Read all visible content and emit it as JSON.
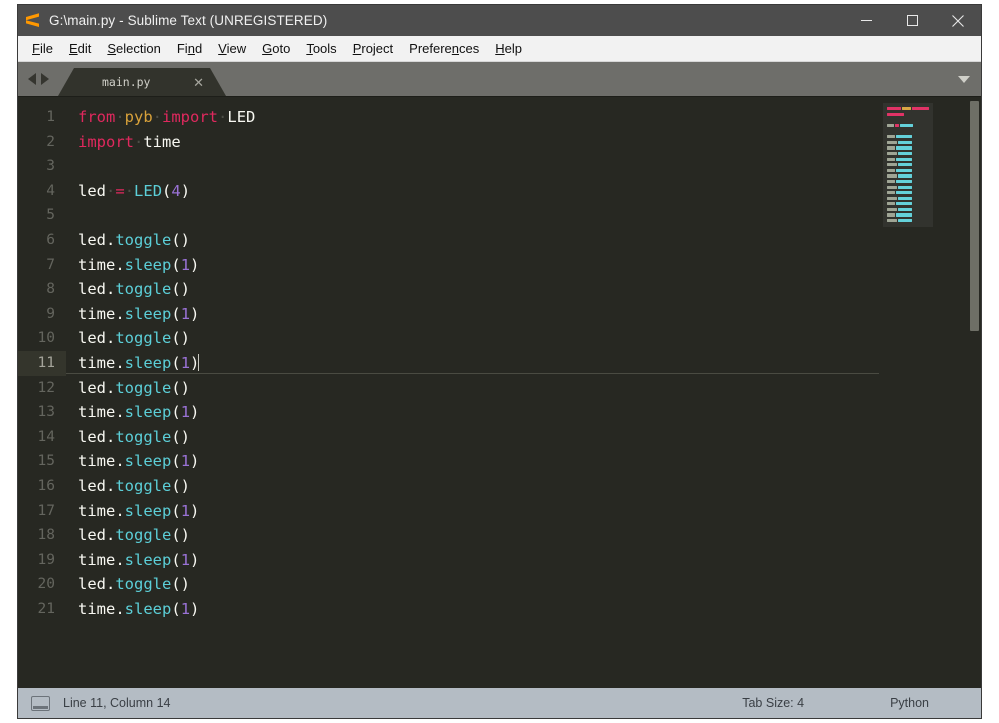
{
  "window": {
    "title": "G:\\main.py - Sublime Text (UNREGISTERED)",
    "logo_name": "sublime-text-logo",
    "controls": {
      "minimize": "–",
      "maximize": "□",
      "close": "✕"
    }
  },
  "menubar": {
    "items": [
      {
        "label": "File",
        "pre": "",
        "mnemonic": "F",
        "post": "ile"
      },
      {
        "label": "Edit",
        "pre": "",
        "mnemonic": "E",
        "post": "dit"
      },
      {
        "label": "Selection",
        "pre": "",
        "mnemonic": "S",
        "post": "election"
      },
      {
        "label": "Find",
        "pre": "Fi",
        "mnemonic": "n",
        "post": "d"
      },
      {
        "label": "View",
        "pre": "",
        "mnemonic": "V",
        "post": "iew"
      },
      {
        "label": "Goto",
        "pre": "",
        "mnemonic": "G",
        "post": "oto"
      },
      {
        "label": "Tools",
        "pre": "",
        "mnemonic": "T",
        "post": "ools"
      },
      {
        "label": "Project",
        "pre": "",
        "mnemonic": "P",
        "post": "roject"
      },
      {
        "label": "Preferences",
        "pre": "Prefere",
        "mnemonic": "n",
        "post": "ces"
      },
      {
        "label": "Help",
        "pre": "",
        "mnemonic": "H",
        "post": "elp"
      }
    ]
  },
  "tabbar": {
    "nav_prev": "previous-tab-arrow",
    "nav_next": "next-tab-arrow",
    "tabs": [
      {
        "label": "main.py",
        "active": true,
        "close": "✕"
      }
    ],
    "overflow": "tab-overflow-chevron"
  },
  "editor": {
    "active_line": 11,
    "caret_line": 11,
    "lines": [
      {
        "n": 1,
        "tokens": [
          {
            "t": "from",
            "c": "kw"
          },
          {
            "t": "·",
            "c": "ws"
          },
          {
            "t": "pyb",
            "c": "mod"
          },
          {
            "t": "·",
            "c": "ws"
          },
          {
            "t": "import",
            "c": "kw"
          },
          {
            "t": "·",
            "c": "ws"
          },
          {
            "t": "LED",
            "c": "pl"
          }
        ]
      },
      {
        "n": 2,
        "tokens": [
          {
            "t": "import",
            "c": "kw"
          },
          {
            "t": "·",
            "c": "ws"
          },
          {
            "t": "time",
            "c": "pl"
          }
        ]
      },
      {
        "n": 3,
        "tokens": []
      },
      {
        "n": 4,
        "tokens": [
          {
            "t": "led",
            "c": "pl"
          },
          {
            "t": "·",
            "c": "ws"
          },
          {
            "t": "=",
            "c": "op"
          },
          {
            "t": "·",
            "c": "ws"
          },
          {
            "t": "LED",
            "c": "fn"
          },
          {
            "t": "(",
            "c": "pl"
          },
          {
            "t": "4",
            "c": "num"
          },
          {
            "t": ")",
            "c": "pl"
          }
        ]
      },
      {
        "n": 5,
        "tokens": []
      },
      {
        "n": 6,
        "tokens": [
          {
            "t": "led.",
            "c": "pl"
          },
          {
            "t": "toggle",
            "c": "fn"
          },
          {
            "t": "()",
            "c": "pl"
          }
        ]
      },
      {
        "n": 7,
        "tokens": [
          {
            "t": "time.",
            "c": "pl"
          },
          {
            "t": "sleep",
            "c": "fn"
          },
          {
            "t": "(",
            "c": "pl"
          },
          {
            "t": "1",
            "c": "num"
          },
          {
            "t": ")",
            "c": "pl"
          }
        ]
      },
      {
        "n": 8,
        "tokens": [
          {
            "t": "led.",
            "c": "pl"
          },
          {
            "t": "toggle",
            "c": "fn"
          },
          {
            "t": "()",
            "c": "pl"
          }
        ]
      },
      {
        "n": 9,
        "tokens": [
          {
            "t": "time.",
            "c": "pl"
          },
          {
            "t": "sleep",
            "c": "fn"
          },
          {
            "t": "(",
            "c": "pl"
          },
          {
            "t": "1",
            "c": "num"
          },
          {
            "t": ")",
            "c": "pl"
          }
        ]
      },
      {
        "n": 10,
        "tokens": [
          {
            "t": "led.",
            "c": "pl"
          },
          {
            "t": "toggle",
            "c": "fn"
          },
          {
            "t": "()",
            "c": "pl"
          }
        ]
      },
      {
        "n": 11,
        "tokens": [
          {
            "t": "time.",
            "c": "pl"
          },
          {
            "t": "sleep",
            "c": "fn"
          },
          {
            "t": "(",
            "c": "pl"
          },
          {
            "t": "1",
            "c": "num"
          },
          {
            "t": ")",
            "c": "pl"
          }
        ],
        "caret": true
      },
      {
        "n": 12,
        "tokens": [
          {
            "t": "led.",
            "c": "pl"
          },
          {
            "t": "toggle",
            "c": "fn"
          },
          {
            "t": "()",
            "c": "pl"
          }
        ]
      },
      {
        "n": 13,
        "tokens": [
          {
            "t": "time.",
            "c": "pl"
          },
          {
            "t": "sleep",
            "c": "fn"
          },
          {
            "t": "(",
            "c": "pl"
          },
          {
            "t": "1",
            "c": "num"
          },
          {
            "t": ")",
            "c": "pl"
          }
        ]
      },
      {
        "n": 14,
        "tokens": [
          {
            "t": "led.",
            "c": "pl"
          },
          {
            "t": "toggle",
            "c": "fn"
          },
          {
            "t": "()",
            "c": "pl"
          }
        ]
      },
      {
        "n": 15,
        "tokens": [
          {
            "t": "time.",
            "c": "pl"
          },
          {
            "t": "sleep",
            "c": "fn"
          },
          {
            "t": "(",
            "c": "pl"
          },
          {
            "t": "1",
            "c": "num"
          },
          {
            "t": ")",
            "c": "pl"
          }
        ]
      },
      {
        "n": 16,
        "tokens": [
          {
            "t": "led.",
            "c": "pl"
          },
          {
            "t": "toggle",
            "c": "fn"
          },
          {
            "t": "()",
            "c": "pl"
          }
        ]
      },
      {
        "n": 17,
        "tokens": [
          {
            "t": "time.",
            "c": "pl"
          },
          {
            "t": "sleep",
            "c": "fn"
          },
          {
            "t": "(",
            "c": "pl"
          },
          {
            "t": "1",
            "c": "num"
          },
          {
            "t": ")",
            "c": "pl"
          }
        ]
      },
      {
        "n": 18,
        "tokens": [
          {
            "t": "led.",
            "c": "pl"
          },
          {
            "t": "toggle",
            "c": "fn"
          },
          {
            "t": "()",
            "c": "pl"
          }
        ]
      },
      {
        "n": 19,
        "tokens": [
          {
            "t": "time.",
            "c": "pl"
          },
          {
            "t": "sleep",
            "c": "fn"
          },
          {
            "t": "(",
            "c": "pl"
          },
          {
            "t": "1",
            "c": "num"
          },
          {
            "t": ")",
            "c": "pl"
          }
        ]
      },
      {
        "n": 20,
        "tokens": [
          {
            "t": "led.",
            "c": "pl"
          },
          {
            "t": "toggle",
            "c": "fn"
          },
          {
            "t": "()",
            "c": "pl"
          }
        ]
      },
      {
        "n": 21,
        "tokens": [
          {
            "t": "time.",
            "c": "pl"
          },
          {
            "t": "sleep",
            "c": "fn"
          },
          {
            "t": "(",
            "c": "pl"
          },
          {
            "t": "1",
            "c": "num"
          },
          {
            "t": ")",
            "c": "pl"
          }
        ]
      }
    ],
    "minimap": [
      [
        {
          "w": 14,
          "c": "#e0285e"
        },
        {
          "w": 9,
          "c": "#d8a13a"
        },
        {
          "w": 17,
          "c": "#e0285e"
        }
      ],
      [
        {
          "w": 17,
          "c": "#e0285e"
        }
      ],
      [],
      [
        {
          "w": 7,
          "c": "#9aa08f"
        },
        {
          "w": 4,
          "c": "#e0285e"
        },
        {
          "w": 13,
          "c": "#5ccfd8"
        }
      ],
      [],
      [
        {
          "w": 8,
          "c": "#9aa08f"
        },
        {
          "w": 16,
          "c": "#5ccfd8"
        }
      ],
      [
        {
          "w": 10,
          "c": "#9aa08f"
        },
        {
          "w": 14,
          "c": "#5ccfd8"
        }
      ],
      [
        {
          "w": 8,
          "c": "#9aa08f"
        },
        {
          "w": 16,
          "c": "#5ccfd8"
        }
      ],
      [
        {
          "w": 10,
          "c": "#9aa08f"
        },
        {
          "w": 14,
          "c": "#5ccfd8"
        }
      ],
      [
        {
          "w": 8,
          "c": "#9aa08f"
        },
        {
          "w": 16,
          "c": "#5ccfd8"
        }
      ],
      [
        {
          "w": 10,
          "c": "#9aa08f"
        },
        {
          "w": 14,
          "c": "#5ccfd8"
        }
      ],
      [
        {
          "w": 8,
          "c": "#9aa08f"
        },
        {
          "w": 16,
          "c": "#5ccfd8"
        }
      ],
      [
        {
          "w": 10,
          "c": "#9aa08f"
        },
        {
          "w": 14,
          "c": "#5ccfd8"
        }
      ],
      [
        {
          "w": 8,
          "c": "#9aa08f"
        },
        {
          "w": 16,
          "c": "#5ccfd8"
        }
      ],
      [
        {
          "w": 10,
          "c": "#9aa08f"
        },
        {
          "w": 14,
          "c": "#5ccfd8"
        }
      ],
      [
        {
          "w": 8,
          "c": "#9aa08f"
        },
        {
          "w": 16,
          "c": "#5ccfd8"
        }
      ],
      [
        {
          "w": 10,
          "c": "#9aa08f"
        },
        {
          "w": 14,
          "c": "#5ccfd8"
        }
      ],
      [
        {
          "w": 8,
          "c": "#9aa08f"
        },
        {
          "w": 16,
          "c": "#5ccfd8"
        }
      ],
      [
        {
          "w": 10,
          "c": "#9aa08f"
        },
        {
          "w": 14,
          "c": "#5ccfd8"
        }
      ],
      [
        {
          "w": 8,
          "c": "#9aa08f"
        },
        {
          "w": 16,
          "c": "#5ccfd8"
        }
      ],
      [
        {
          "w": 10,
          "c": "#9aa08f"
        },
        {
          "w": 14,
          "c": "#5ccfd8"
        }
      ]
    ]
  },
  "statusbar": {
    "console_icon": "console-toggle-icon",
    "position": "Line 11, Column 14",
    "tab_size": "Tab Size: 4",
    "language": "Python"
  },
  "colors": {
    "editor_bg": "#272822",
    "keyword": "#e0285e",
    "function": "#5ccfd8",
    "number": "#9a72d6",
    "module": "#d8a13a",
    "plain": "#f8f8f2",
    "titlebar_bg": "#4d4d4d",
    "tabbar_bg": "#6e6e6a",
    "statusbar_bg": "#b4bcc4",
    "accent_logo": "#ff9800"
  }
}
